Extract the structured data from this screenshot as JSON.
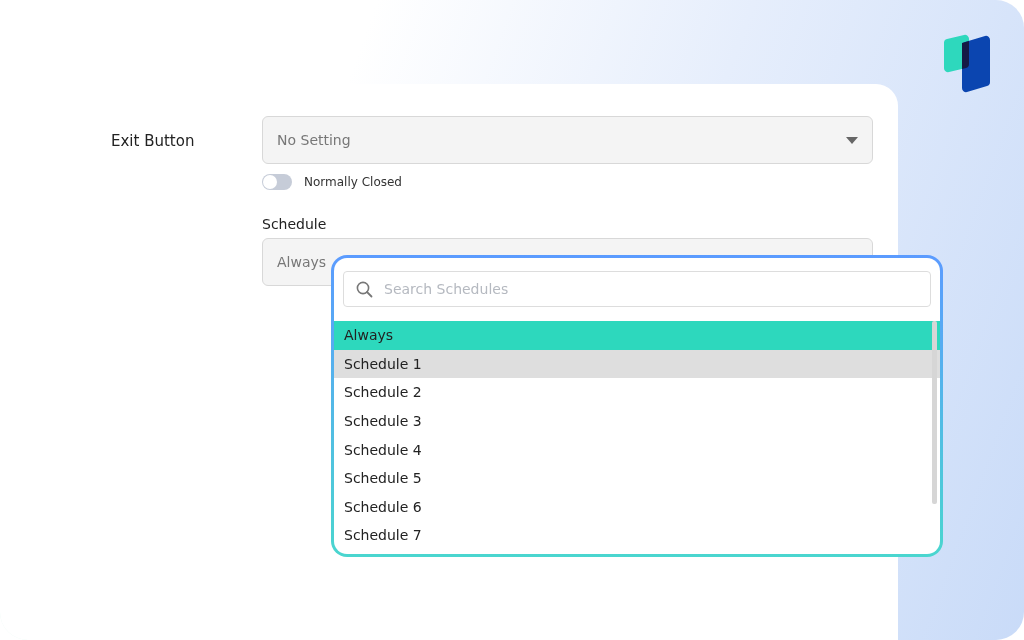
{
  "form": {
    "exit_button": {
      "label": "Exit Button",
      "value": "No Setting"
    },
    "toggle": {
      "label": "Normally Closed",
      "on": false
    },
    "schedule": {
      "label": "Schedule",
      "value": "Always"
    }
  },
  "schedule_dropdown": {
    "search": {
      "placeholder": "Search Schedules"
    },
    "items": [
      {
        "label": "Always",
        "selected": true,
        "hovered": false
      },
      {
        "label": "Schedule 1",
        "selected": false,
        "hovered": true
      },
      {
        "label": "Schedule 2",
        "selected": false,
        "hovered": false
      },
      {
        "label": "Schedule 3",
        "selected": false,
        "hovered": false
      },
      {
        "label": "Schedule 4",
        "selected": false,
        "hovered": false
      },
      {
        "label": "Schedule 5",
        "selected": false,
        "hovered": false
      },
      {
        "label": "Schedule 6",
        "selected": false,
        "hovered": false
      },
      {
        "label": "Schedule 7",
        "selected": false,
        "hovered": false
      }
    ]
  }
}
